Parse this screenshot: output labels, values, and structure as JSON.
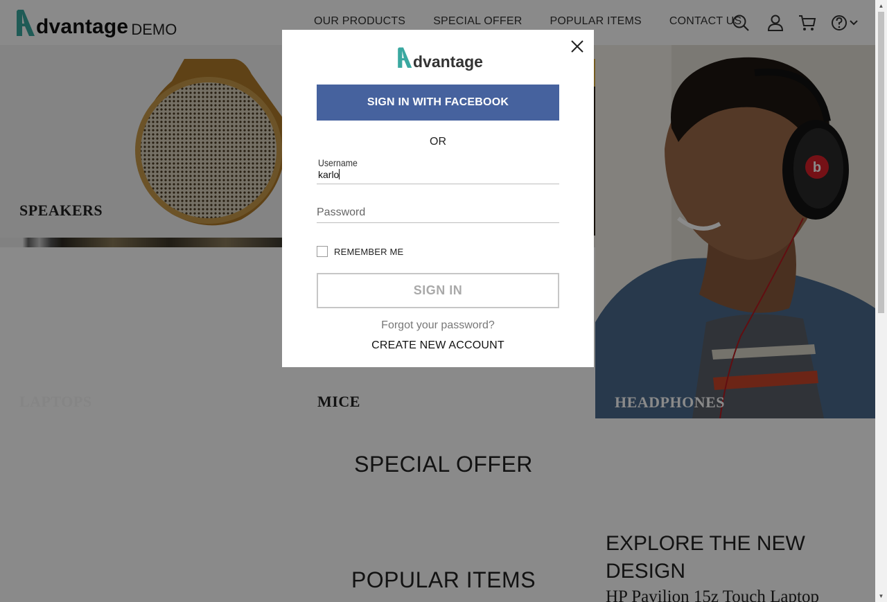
{
  "header": {
    "logo_word": "dvantage",
    "logo_demo": "DEMO",
    "nav": [
      "OUR PRODUCTS",
      "SPECIAL OFFER",
      "POPULAR ITEMS",
      "CONTACT US"
    ],
    "icons": [
      "search-icon",
      "user-icon",
      "cart-icon",
      "help-icon",
      "chevron-down-icon"
    ]
  },
  "categories": {
    "speakers": "SPEAKERS",
    "laptops": "LAPTOPS",
    "mice": "MICE",
    "headphones": "HEADPHONES"
  },
  "sections": {
    "special_offer": "SPECIAL OFFER",
    "popular_items": "POPULAR ITEMS",
    "explore_title": "EXPLORE THE NEW DESIGN",
    "explore_product": "HP Pavilion 15z Touch Laptop"
  },
  "modal": {
    "logo_word": "dvantage",
    "facebook_button": "SIGN IN WITH FACEBOOK",
    "or": "OR",
    "username_label": "Username",
    "username_value": "karlo",
    "password_placeholder": "Password",
    "remember_me": "REMEMBER ME",
    "signin_button": "SIGN IN",
    "forgot_password": "Forgot your password?",
    "create_account": "CREATE NEW ACCOUNT"
  },
  "colors": {
    "brand_teal": "#3aa8a0",
    "facebook": "#46629e",
    "overlay": "rgba(0,0,0,0.46)"
  }
}
